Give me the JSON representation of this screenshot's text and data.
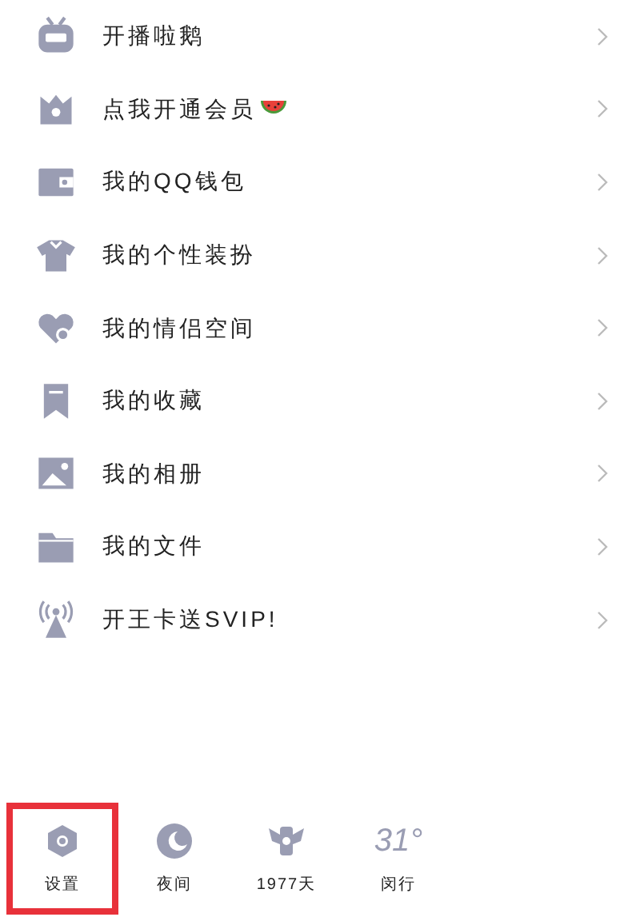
{
  "menu": [
    {
      "kind": "tv",
      "label": "开播啦鹅"
    },
    {
      "kind": "crown",
      "label": "点我开通会员",
      "melon": true
    },
    {
      "kind": "wallet",
      "label": "我的QQ钱包"
    },
    {
      "kind": "shirt",
      "label": "我的个性装扮"
    },
    {
      "kind": "heart",
      "label": "我的情侣空间"
    },
    {
      "kind": "bookmark",
      "label": "我的收藏"
    },
    {
      "kind": "image",
      "label": "我的相册"
    },
    {
      "kind": "folder",
      "label": "我的文件"
    },
    {
      "kind": "antenna",
      "label": "开王卡送SVIP!"
    }
  ],
  "bottom_bar": [
    {
      "kind": "settings",
      "label": "设置",
      "highlighted": true
    },
    {
      "kind": "moon",
      "label": "夜间",
      "highlighted": false
    },
    {
      "kind": "wings",
      "label": "1977天",
      "highlighted": false
    },
    {
      "kind": "weather",
      "temperature": "31°",
      "label": "闵行",
      "highlighted": false
    }
  ]
}
